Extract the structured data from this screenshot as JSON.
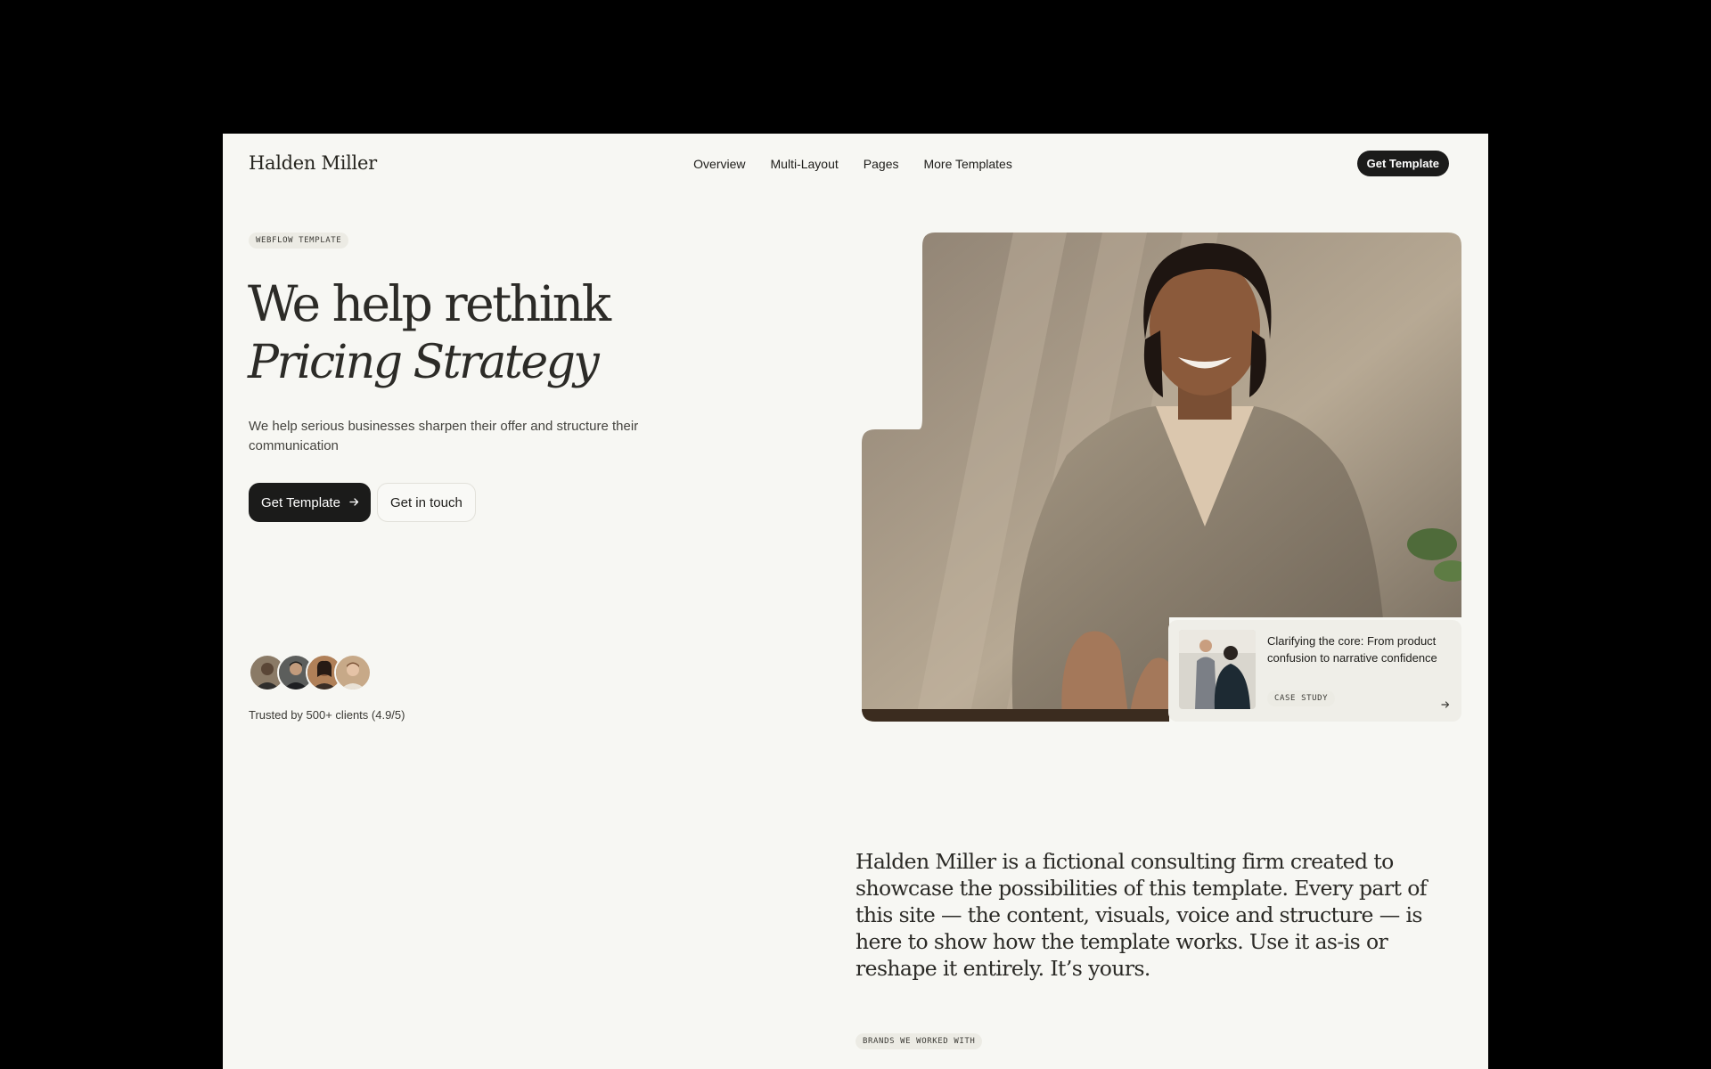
{
  "brand": {
    "logo": "Halden Miller"
  },
  "nav": {
    "items": [
      "Overview",
      "Multi-Layout",
      "Pages",
      "More Templates"
    ],
    "cta": "Get Template"
  },
  "hero": {
    "tag": "WEBFLOW TEMPLATE",
    "headline_line1": "We help rethink",
    "headline_line2": "Pricing Strategy",
    "subcopy": "We help serious businesses sharpen their offer and structure their communication",
    "primary_button": "Get Template",
    "primary_button_icon": "arrow-right-icon",
    "secondary_button": "Get in touch",
    "trust_text": "Trusted by 500+ clients (4.9/5)",
    "avatar_count": 4
  },
  "case_study": {
    "title": "Clarifying the core: From product confusion to narrative confidence",
    "tag": "CASE STUDY",
    "arrow_icon": "arrow-right-icon"
  },
  "about": {
    "text": "Halden Miller is a fictional consulting firm created to showcase the possibilities of this template. Every part of this site — the content, visuals, voice and structure — is here to show how the template works. Use it as-is or reshape it entirely. It’s yours."
  },
  "brands": {
    "tag": "BRANDS WE WORKED WITH"
  },
  "colors": {
    "page_bg": "#f7f7f3",
    "outer_bg": "#000000",
    "dark_button": "#1b1b1a",
    "text": "#2c2b27",
    "tag_bg": "#ecebe4"
  }
}
